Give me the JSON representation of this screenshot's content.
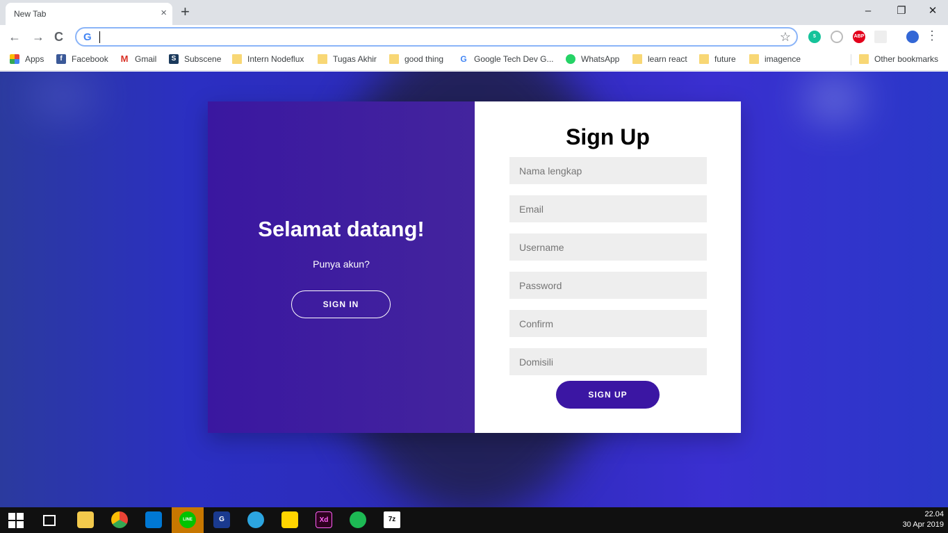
{
  "browser": {
    "tab_title": "New Tab",
    "tab_close": "×",
    "new_tab": "+",
    "window_controls": {
      "minimize": "–",
      "restore": "❐",
      "close": "✕"
    },
    "nav": {
      "back": "←",
      "forward": "→",
      "reload": "C"
    },
    "omnibox": {
      "engine_icon": "G",
      "value": "",
      "star": "☆"
    },
    "extensions": [
      {
        "name": "grammarly-icon",
        "label": "5",
        "color": "#15c39a"
      },
      {
        "name": "shield-icon",
        "label": "",
        "color": "#c0c0c0"
      },
      {
        "name": "adblock-icon",
        "label": "ABP",
        "color": "#e3001b"
      },
      {
        "name": "extension-icon",
        "label": "",
        "color": "#e8e8e8"
      },
      {
        "name": "profile-avatar-icon",
        "label": "",
        "color": "#3367d6"
      }
    ],
    "menu": "⋮"
  },
  "bookmarks": [
    {
      "label": "Apps",
      "icon": "apps-grid-icon"
    },
    {
      "label": "Facebook",
      "icon": "facebook-icon"
    },
    {
      "label": "Gmail",
      "icon": "gmail-icon"
    },
    {
      "label": "Subscene",
      "icon": "subscene-icon"
    },
    {
      "label": "Intern Nodeflux",
      "icon": "folder-icon"
    },
    {
      "label": "Tugas Akhir",
      "icon": "folder-icon"
    },
    {
      "label": "good thing",
      "icon": "folder-icon"
    },
    {
      "label": "Google Tech Dev G...",
      "icon": "google-icon"
    },
    {
      "label": "WhatsApp",
      "icon": "whatsapp-icon"
    },
    {
      "label": "learn react",
      "icon": "folder-icon"
    },
    {
      "label": "future",
      "icon": "folder-icon"
    },
    {
      "label": "imagence",
      "icon": "folder-icon"
    }
  ],
  "other_bookmarks": "Other bookmarks",
  "page": {
    "welcome_title": "Selamat datang!",
    "have_account": "Punya akun?",
    "signin_label": "SIGN IN",
    "form_title": "Sign Up",
    "fields": {
      "fullname": "Nama lengkap",
      "email": "Email",
      "username": "Username",
      "password": "Password",
      "confirm": "Confirm",
      "domicile": "Domisili"
    },
    "signup_label": "SIGN UP",
    "accent_color": "#3b16a3"
  },
  "taskbar": {
    "time": "22.04",
    "date": "30 Apr 2019"
  }
}
